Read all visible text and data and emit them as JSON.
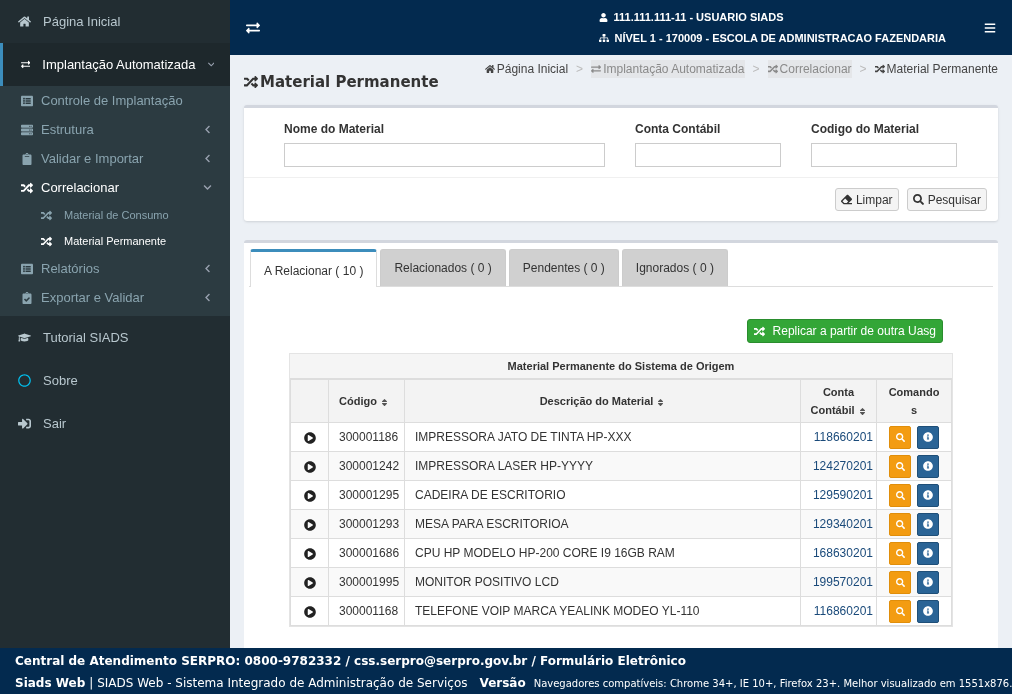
{
  "sidebar": {
    "items": [
      {
        "label": "Página Inicial",
        "selected": false
      },
      {
        "label": "Implantação Automatizada",
        "selected": true,
        "expanded": true,
        "children": [
          {
            "label": "Controle de Implantação",
            "selected": false
          },
          {
            "label": "Estrutura",
            "selected": false,
            "expanded": false
          },
          {
            "label": "Validar e Importar",
            "selected": false,
            "expanded": false
          },
          {
            "label": "Correlacionar",
            "selected": true,
            "expanded": true,
            "children": [
              {
                "label": "Material de Consumo",
                "selected": false
              },
              {
                "label": "Material Permanente",
                "selected": true
              }
            ]
          },
          {
            "label": "Relatórios",
            "selected": false,
            "expanded": false
          },
          {
            "label": "Exportar e Validar",
            "selected": false,
            "expanded": false
          }
        ]
      },
      {
        "label": "Tutorial SIADS",
        "selected": false
      },
      {
        "label": "Sobre",
        "selected": false
      },
      {
        "label": "Sair",
        "selected": false
      }
    ]
  },
  "header": {
    "user": "111.111.111-11 - USUARIO SIADS",
    "unit": "NÍVEL 1 - 170009 - ESCOLA DE ADMINISTRACAO FAZENDARIA"
  },
  "page_title": "Material Permanente",
  "breadcrumb": [
    {
      "label": "Página Inicial",
      "disabled": false
    },
    {
      "label": "Implantação Automatizada",
      "disabled": true
    },
    {
      "label": "Correlacionar",
      "disabled": true
    },
    {
      "label": "Material Permanente",
      "disabled": false
    }
  ],
  "breadcrumb_separator": ">",
  "filters": {
    "fields": [
      {
        "label": "Nome do Material"
      },
      {
        "label": "Conta Contábil"
      },
      {
        "label": "Codigo do Material"
      }
    ],
    "buttons": [
      "Limpar",
      "Pesquisar"
    ]
  },
  "tabs": [
    {
      "label": "A Relacionar ( 10 )",
      "selected": true
    },
    {
      "label": "Relacionados ( 0 )",
      "selected": false
    },
    {
      "label": "Pendentes ( 0 )",
      "selected": false
    },
    {
      "label": "Ignorados ( 0 )",
      "selected": false
    }
  ],
  "replicate_button": "Replicar a partir de outra Uasg",
  "table": {
    "title": "Material Permanente do Sistema de Origem",
    "columns": [
      {
        "label": "Código",
        "sortable": true
      },
      {
        "label": "Descrição do Material",
        "sortable": true
      },
      {
        "label": "Conta Contábil",
        "sortable": true
      },
      {
        "label": "Comandos",
        "sortable": false
      }
    ],
    "rows": [
      {
        "codigo": "300001186",
        "descricao": "IMPRESSORA JATO DE TINTA HP-XXX",
        "conta": "118660201"
      },
      {
        "codigo": "300001242",
        "descricao": "IMPRESSORA LASER HP-YYYY",
        "conta": "124270201"
      },
      {
        "codigo": "300001295",
        "descricao": "CADEIRA DE ESCRITORIO",
        "conta": "129590201"
      },
      {
        "codigo": "300001293",
        "descricao": "MESA PARA ESCRITORIOA",
        "conta": "129340201"
      },
      {
        "codigo": "300001686",
        "descricao": "CPU HP MODELO HP-200 CORE I9 16GB RAM",
        "conta": "168630201"
      },
      {
        "codigo": "300001995",
        "descricao": "MONITOR POSITIVO LCD",
        "conta": "199570201"
      },
      {
        "codigo": "300001168",
        "descricao": "TELEFONE VOIP MARCA YEALINK MODEO YL-110",
        "conta": "116860201"
      }
    ]
  },
  "footer": {
    "line1": "Central de Atendimento SERPRO: 0800-9782332 / css.serpro@serpro.gov.br / Formulário Eletrônico",
    "app": "Siads Web",
    "app_desc": "| SIADS Web - Sistema Integrado de Administração de Serviços",
    "version_label": "Versão",
    "browsers": "Navegadores compatíveis: Chrome 34+, IE 10+, Firefox 23+. Melhor visualizado em 1551x876."
  }
}
